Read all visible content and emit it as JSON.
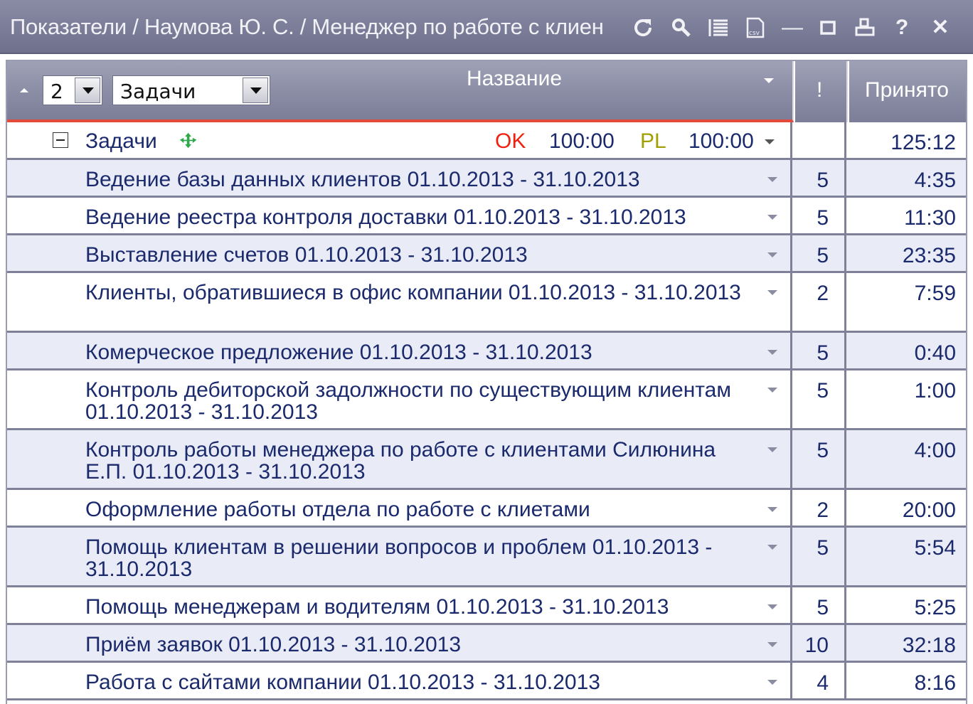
{
  "window": {
    "title": "Показатели / Наумова Ю. С. / Менеджер по работе с клиен"
  },
  "toolbar": {
    "icons": [
      "refresh-icon",
      "search-icon",
      "columns-icon",
      "csv-export-icon",
      "minimize-icon",
      "maximize-icon",
      "print-icon",
      "help-icon",
      "close-icon"
    ],
    "minimize_glyph": "—",
    "help_glyph": "?",
    "close_glyph": "✕"
  },
  "header": {
    "level_value": "2",
    "grouping_value": "Задачи",
    "col_name": "Название",
    "col_priority": "!",
    "col_accepted": "Принято",
    "colors": {
      "header": "#8e90a8",
      "accent_line": "#e34a3c"
    }
  },
  "group": {
    "title": "Задачи",
    "ok_label": "OK",
    "ok_value": "100:00",
    "pl_label": "PL",
    "pl_value": "100:00",
    "accepted": "125:12",
    "colors": {
      "ok": "#f02010",
      "pl": "#a0a000",
      "plus": "#2ea84a"
    }
  },
  "rows": [
    {
      "name": "Ведение базы данных клиентов 01.10.2013 - 31.10.2013",
      "priority": "5",
      "accepted": "4:35"
    },
    {
      "name": "Ведение реестра контроля доставки 01.10.2013 - 31.10.2013",
      "priority": "5",
      "accepted": "11:30"
    },
    {
      "name": "Выставление счетов 01.10.2013 - 31.10.2013",
      "priority": "5",
      "accepted": "23:35"
    },
    {
      "name": "Клиенты, обратившиеся в офис компании 01.10.2013 - 31.10.2013",
      "priority": "2",
      "accepted": "7:59"
    },
    {
      "name": "Комерческое предложение 01.10.2013 - 31.10.2013",
      "priority": "5",
      "accepted": "0:40"
    },
    {
      "name": "Контроль дебиторской задолжности по существующим клиентам 01.10.2013 - 31.10.2013",
      "priority": "5",
      "accepted": "1:00"
    },
    {
      "name": "Контроль работы менеджера по работе с клиентами Силюнина Е.П. 01.10.2013 - 31.10.2013",
      "priority": "5",
      "accepted": "4:00"
    },
    {
      "name": "Оформление работы отдела по работе с клиетами",
      "priority": "2",
      "accepted": "20:00"
    },
    {
      "name": "Помощь клиентам в решении вопросов и проблем 01.10.2013 - 31.10.2013",
      "priority": "5",
      "accepted": "5:54"
    },
    {
      "name": "Помощь менеджерам и водителям 01.10.2013 - 31.10.2013",
      "priority": "5",
      "accepted": "5:25"
    },
    {
      "name": "Приём заявок 01.10.2013 - 31.10.2013",
      "priority": "10",
      "accepted": "32:18"
    },
    {
      "name": "Работа с сайтами компании 01.10.2013 - 31.10.2013",
      "priority": "4",
      "accepted": "8:16"
    }
  ]
}
